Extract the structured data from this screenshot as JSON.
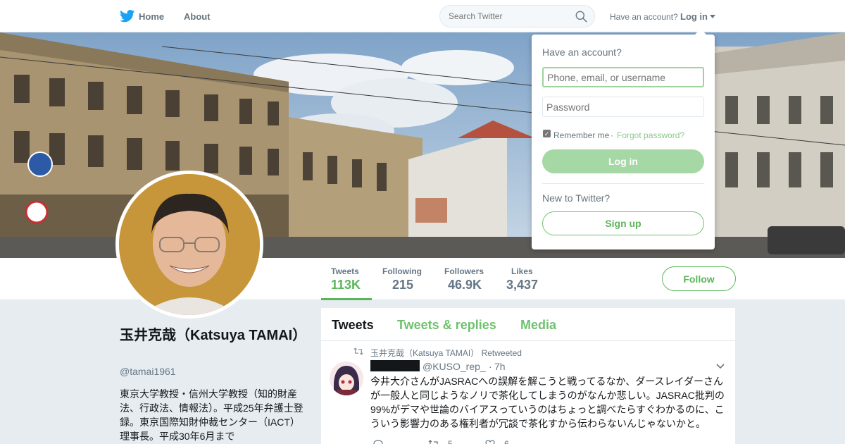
{
  "colors": {
    "accent": "#5ab65a",
    "accent_light": "#a5d8a5",
    "text": "#14171a",
    "muted": "#657786"
  },
  "nav": {
    "brand_icon": "bird-icon",
    "home_label": "Home",
    "about_label": "About",
    "search_placeholder": "Search Twitter",
    "have_account": "Have an account?",
    "login_label": "Log in"
  },
  "profile_nav": {
    "stats": [
      {
        "label": "Tweets",
        "value": "113K"
      },
      {
        "label": "Following",
        "value": "215"
      },
      {
        "label": "Followers",
        "value": "46.9K"
      },
      {
        "label": "Likes",
        "value": "3,437"
      }
    ],
    "follow_label": "Follow"
  },
  "profile": {
    "name": "玉井克哉（Katsuya TAMAI）",
    "handle": "@tamai1961",
    "bio": "東京大学教授・信州大学教授（知的財産法、行政法、情報法）。平成25年弁護士登録。東京国際知財仲裁センター（IACT）理事長。平成30年6月まで"
  },
  "timeline": {
    "tabs": [
      "Tweets",
      "Tweets & replies",
      "Media"
    ],
    "tweet": {
      "retweeted_by": "玉井克哉（Katsuya TAMAI） Retweeted",
      "handle": "@KUSO_rep_",
      "separator": "·",
      "time": "7h",
      "text": "今井大介さんがJASRACへの誤解を解こうと戦ってるなか、ダースレイダーさんが一般人と同じようなノリで茶化してしまうのがなんか悲しい。JASRAC批判の99%がデマや世論のバイアスっていうのはちょっと調べたらすぐわかるのに、こういう影響力のある権利者が冗談で茶化すから伝わらないんじゃないかと。",
      "retweet_count": "5",
      "like_count": "6"
    }
  },
  "login_dropdown": {
    "title": "Have an account?",
    "user_placeholder": "Phone, email, or username",
    "pass_placeholder": "Password",
    "remember_label": "Remember me",
    "separator": "·",
    "forgot_label": "Forgot password?",
    "login_button": "Log in",
    "new_label": "New to Twitter?",
    "signup_button": "Sign up"
  }
}
